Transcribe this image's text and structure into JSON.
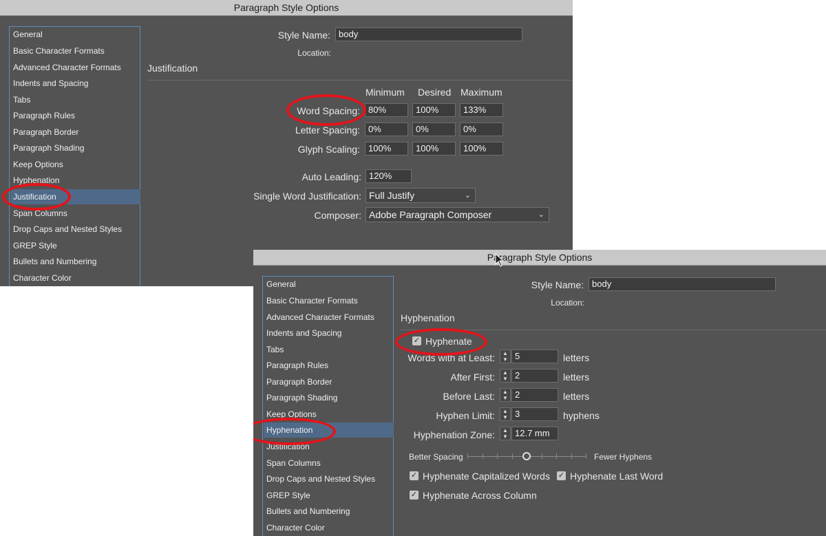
{
  "dialog_top": {
    "title": "Paragraph Style Options",
    "style_name_label": "Style Name:",
    "style_name_value": "body",
    "location_label": "Location:",
    "section_title": "Justification",
    "categories": [
      "General",
      "Basic Character Formats",
      "Advanced Character Formats",
      "Indents and Spacing",
      "Tabs",
      "Paragraph Rules",
      "Paragraph Border",
      "Paragraph Shading",
      "Keep Options",
      "Hyphenation",
      "Justification",
      "Span Columns",
      "Drop Caps and Nested Styles",
      "GREP Style",
      "Bullets and Numbering",
      "Character Color"
    ],
    "selected_category": "Justification",
    "col_headers": [
      "Minimum",
      "Desired",
      "Maximum"
    ],
    "rows": [
      {
        "label": "Word Spacing:",
        "values": [
          "80%",
          "100%",
          "133%"
        ]
      },
      {
        "label": "Letter Spacing:",
        "values": [
          "0%",
          "0%",
          "0%"
        ]
      },
      {
        "label": "Glyph Scaling:",
        "values": [
          "100%",
          "100%",
          "100%"
        ]
      }
    ],
    "auto_leading_label": "Auto Leading:",
    "auto_leading_value": "120%",
    "single_word_label": "Single Word Justification:",
    "single_word_value": "Full Justify",
    "composer_label": "Composer:",
    "composer_value": "Adobe Paragraph Composer"
  },
  "dialog_bottom": {
    "title": "Paragraph Style Options",
    "style_name_label": "Style Name:",
    "style_name_value": "body",
    "location_label": "Location:",
    "section_title": "Hyphenation",
    "categories": [
      "General",
      "Basic Character Formats",
      "Advanced Character Formats",
      "Indents and Spacing",
      "Tabs",
      "Paragraph Rules",
      "Paragraph Border",
      "Paragraph Shading",
      "Keep Options",
      "Hyphenation",
      "Justification",
      "Span Columns",
      "Drop Caps and Nested Styles",
      "GREP Style",
      "Bullets and Numbering",
      "Character Color"
    ],
    "selected_category": "Hyphenation",
    "hyphenate_label": "Hyphenate",
    "hyphenate_checked": true,
    "settings": [
      {
        "label": "Words with at Least:",
        "value": "5",
        "unit": "letters"
      },
      {
        "label": "After First:",
        "value": "2",
        "unit": "letters"
      },
      {
        "label": "Before Last:",
        "value": "2",
        "unit": "letters"
      },
      {
        "label": "Hyphen Limit:",
        "value": "3",
        "unit": "hyphens"
      },
      {
        "label": "Hyphenation Zone:",
        "value": "12.7 mm",
        "unit": ""
      }
    ],
    "slider_left_label": "Better Spacing",
    "slider_right_label": "Fewer Hyphens",
    "slider_level": 0.5,
    "options": [
      {
        "label": "Hyphenate Capitalized Words",
        "checked": true
      },
      {
        "label": "Hyphenate Last Word",
        "checked": true
      },
      {
        "label": "Hyphenate Across Column",
        "checked": true
      }
    ]
  },
  "highlight_color": "#e3141b"
}
